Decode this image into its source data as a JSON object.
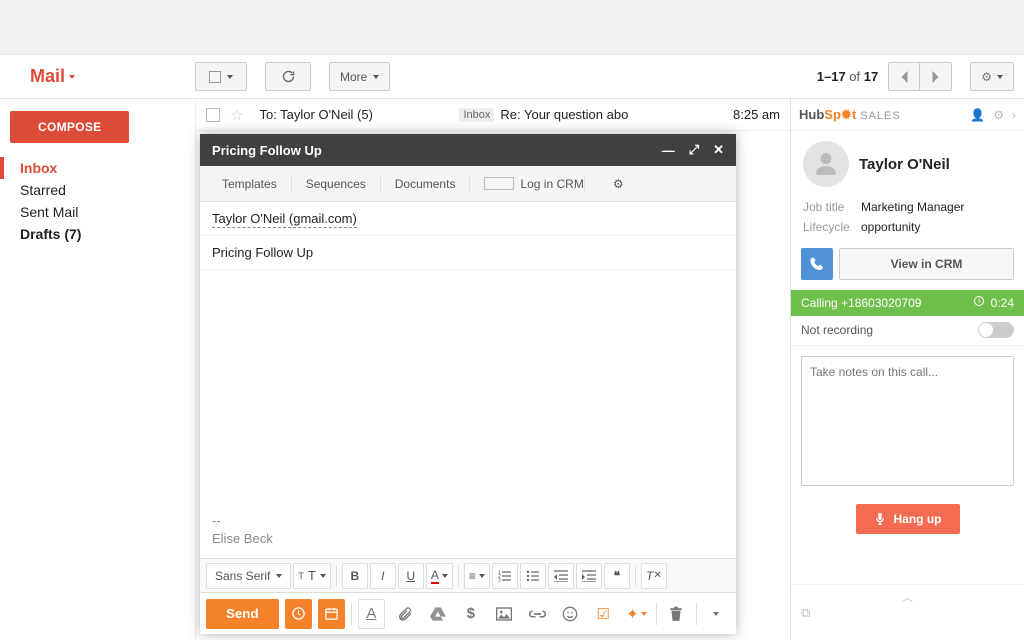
{
  "header": {
    "mail_label": "Mail"
  },
  "toolbar": {
    "more_label": "More",
    "pagination_range": "1–17",
    "pagination_of": "of",
    "pagination_total": "17"
  },
  "sidebar": {
    "compose_label": "COMPOSE",
    "folders": [
      {
        "label": "Inbox",
        "active": true,
        "bold": false
      },
      {
        "label": "Starred",
        "active": false,
        "bold": false
      },
      {
        "label": "Sent Mail",
        "active": false,
        "bold": false
      },
      {
        "label": "Drafts (7)",
        "active": false,
        "bold": true
      }
    ]
  },
  "mail_row": {
    "to": "To: Taylor O'Neil (5)",
    "inbox_tag": "Inbox",
    "subject": "Re: Your question abo",
    "time": "8:25 am"
  },
  "compose": {
    "title": "Pricing Follow Up",
    "tabs": {
      "templates": "Templates",
      "sequences": "Sequences",
      "documents": "Documents",
      "log_crm": "Log in CRM"
    },
    "recipient": "Taylor O'Neil (gmail.com)",
    "subject": "Pricing Follow Up",
    "signature_dashes": "--",
    "signature_name": "Elise Beck",
    "font_label": "Sans Serif",
    "send_label": "Send"
  },
  "hubspot": {
    "logo_part1": "Hub",
    "logo_part2": "Sp",
    "logo_part3": "t",
    "logo_sales": " SALES",
    "contact_name": "Taylor O'Neil",
    "job_title_label": "Job title",
    "job_title_value": "Marketing Manager",
    "lifecycle_label": "Lifecycle",
    "lifecycle_value": "opportunity",
    "view_crm_label": "View in CRM",
    "calling_label": "Calling +18603020709",
    "call_timer": "0:24",
    "recording_label": "Not recording",
    "notes_placeholder": "Take notes on this call...",
    "hangup_label": "Hang up"
  }
}
